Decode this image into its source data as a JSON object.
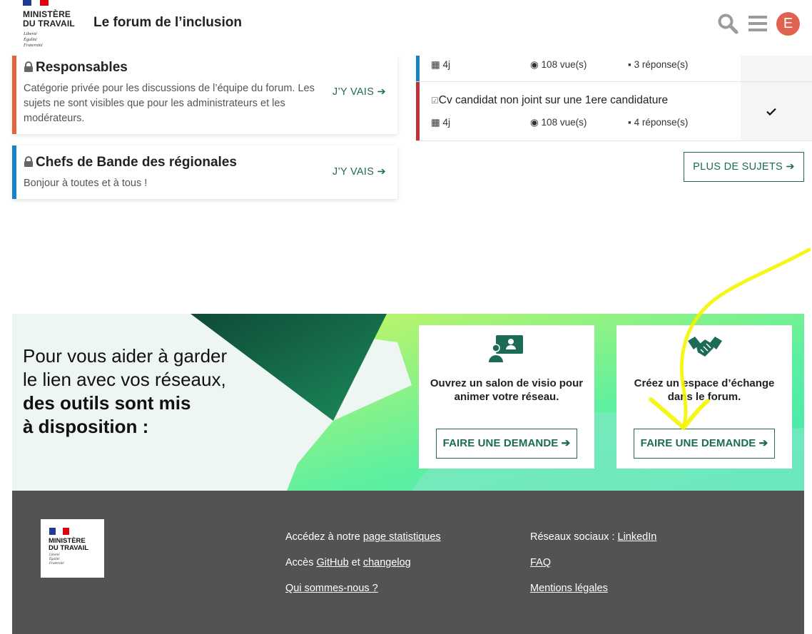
{
  "header": {
    "logo": {
      "line1": "MINISTÈRE",
      "line2": "DU TRAVAIL",
      "motto": [
        "Liberté",
        "Égalité",
        "Fraternité"
      ]
    },
    "title": "Le forum de l’inclusion",
    "icons": [
      "search-icon",
      "menu-icon"
    ],
    "avatar_letter": "E"
  },
  "categories": [
    {
      "title": "Responsables",
      "description": "Catégorie privée pour les discussions de l’équipe du forum. Les sujets ne sont visibles que pour les administrateurs et les modérateurs.",
      "link": "J’Y VAIS",
      "color": "#e4643c"
    },
    {
      "title": "Chefs de Bande des régionales",
      "description": "Bonjour à toutes et à tous !",
      "link": "J’Y VAIS",
      "color": "#1583c6"
    }
  ],
  "topics": [
    {
      "title": "",
      "age": "4j",
      "views": "108 vue(s)",
      "replies": "3 réponse(s)",
      "color": "#1583c6"
    },
    {
      "title": "Cv candidat non joint sur une 1ere candidature",
      "age": "4j",
      "views": "108 vue(s)",
      "replies": "4 réponse(s)",
      "color": "#c0313a",
      "solved_icon": "checkmark-icon"
    }
  ],
  "more_topics": "PLUS DE SUJETS",
  "promo": {
    "line1": "Pour vous aider à garder",
    "line2": "le lien avec vos réseaux,",
    "line3_bold": "des outils sont mis",
    "line4_bold": "à disposition :",
    "cards": [
      {
        "icon": "video-call-icon",
        "text": "Ouvrez un salon de visio pour animer votre réseau.",
        "button": "FAIRE UNE DEMANDE"
      },
      {
        "icon": "handshake-icon",
        "text": "Créez un espace d’échange dans le forum.",
        "button": "FAIRE UNE DEMANDE"
      }
    ]
  },
  "footer": {
    "logo": {
      "line1": "MINISTÈRE",
      "line2": "DU TRAVAIL",
      "motto": [
        "Liberté",
        "Égalité",
        "Fraternité"
      ]
    },
    "col1": [
      {
        "prefix": "Accédez à notre ",
        "link": "page statistiques"
      },
      {
        "prefix": "Accès ",
        "link": "GitHub",
        "middle": " et ",
        "link2": "changelog"
      },
      {
        "link": "Qui sommes-nous ?"
      }
    ],
    "col2": [
      {
        "prefix": "Réseaux sociaux : ",
        "link": "LinkedIn"
      },
      {
        "link": "FAQ"
      },
      {
        "link": "Mentions légales"
      }
    ]
  },
  "annotation_color": "#f5f500",
  "brand_green": "#1c6b57"
}
